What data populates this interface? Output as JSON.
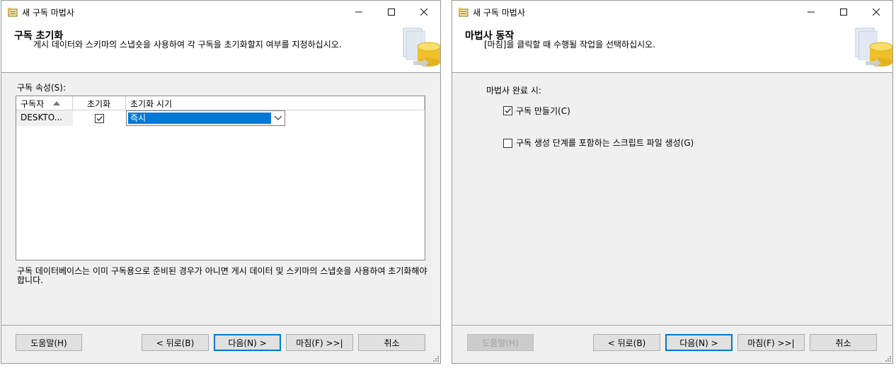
{
  "window1": {
    "title": "새 구독 마법사",
    "header_title": "구독 초기화",
    "header_subtitle": "게시 데이터와 스키마의 스냅숏을 사용하여 각 구독을 초기화할지 여부를 지정하십시오.",
    "grid_label": "구독 속성(S):",
    "columns": [
      "구독자",
      "초기화",
      "초기화 시기"
    ],
    "rows": [
      {
        "subscriber": "DESKTO...",
        "initialize": true,
        "when": "즉시"
      }
    ],
    "note": "구독 데이터베이스는 이미 구독용으로 준비된 경우가 아니면 게시 데이터 및 스키마의 스냅숏을 사용하여 초기화해야 합니다.",
    "buttons": {
      "help": "도움말(H)",
      "back": "< 뒤로(B)",
      "next": "다음(N) >",
      "finish": "마침(F) >>|",
      "cancel": "취소"
    }
  },
  "window2": {
    "title": "새 구독 마법사",
    "header_title": "마법사 동작",
    "header_subtitle": "[마침]을 클릭할 때 수행될 작업을 선택하십시오.",
    "section_label": "마법사 완료 시:",
    "options": [
      {
        "label": "구독 만들기(C)",
        "checked": true
      },
      {
        "label": "구독 생성 단계를 포함하는 스크립트 파일 생성(G)",
        "checked": false
      }
    ],
    "buttons": {
      "help": "도움말(H)",
      "back": "< 뒤로(B)",
      "next": "다음(N) >",
      "finish": "마침(F) >>|",
      "cancel": "취소"
    }
  },
  "colors": {
    "accent": "#0078d7",
    "selection": "#0078d7"
  },
  "icons": {
    "minimize": "minimize-icon",
    "maximize": "maximize-icon",
    "close": "close-icon",
    "wizard": "wizard-db-icon"
  }
}
